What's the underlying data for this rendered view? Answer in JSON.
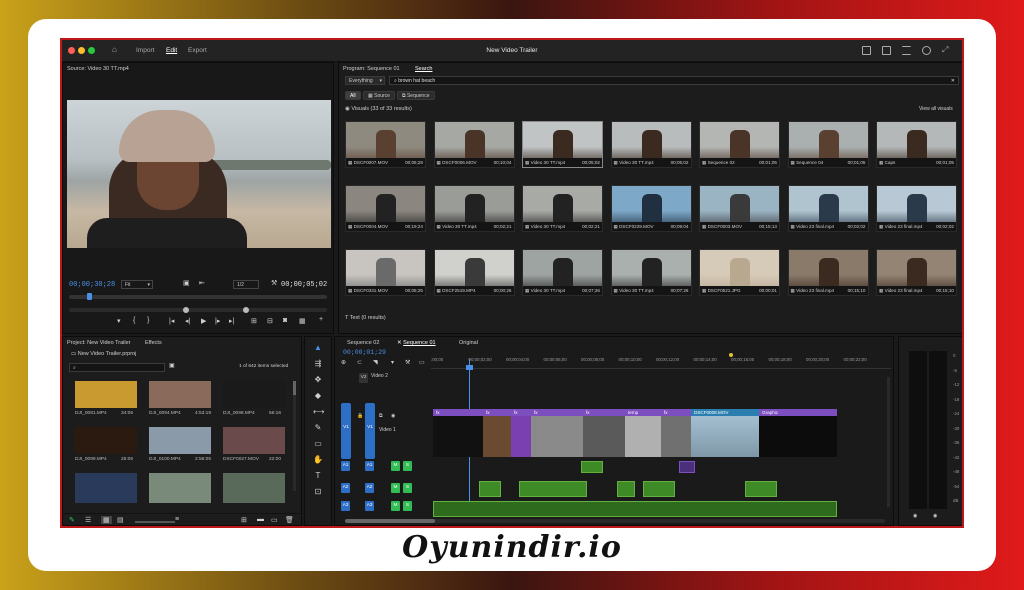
{
  "app": {
    "title": "New Video Trailer",
    "menu": [
      "Import",
      "Edit",
      "Export"
    ],
    "active_menu": "Edit"
  },
  "source": {
    "title": "Source: Video 30 TT.mp4",
    "timecode_in": "00;00;30;28",
    "fit": "Fit",
    "ratio": "1/2",
    "timecode_out": "00;00;05;02"
  },
  "program": {
    "tab": "Program: Sequence 01",
    "search_tab": "Search",
    "filter": "Everything",
    "query": "brown hat beach",
    "chips": [
      "All",
      "Source",
      "Sequence"
    ],
    "visuals_label": "Visuals (33 of 33 results)",
    "view_all": "View all visuals",
    "text_label": "Text (0 results)",
    "thumbs": [
      {
        "name": "DSCF0007.MOV",
        "dur": "00;06;28"
      },
      {
        "name": "DSCF0006.MOV",
        "dur": "00;10;04"
      },
      {
        "name": "Video 30 TT.mp4",
        "dur": "00;05;02"
      },
      {
        "name": "Video 30 TT.mp4",
        "dur": "00;05;02"
      },
      {
        "name": "Sequence 02",
        "dur": "00;01;05"
      },
      {
        "name": "Sequence 04",
        "dur": "00;01;05"
      },
      {
        "name": "Caps",
        "dur": "00;01;05"
      },
      {
        "name": "DSCF0004.MOV",
        "dur": "00;19;24"
      },
      {
        "name": "Video 30 TT.mp4",
        "dur": "00;02;21"
      },
      {
        "name": "Video 30 TT.mp4",
        "dur": "00;02;21"
      },
      {
        "name": "DSCF0229.MOV",
        "dur": "00;09;04"
      },
      {
        "name": "DSCF0003.MOV",
        "dur": "00;15;13"
      },
      {
        "name": "Video 23 final.mp4",
        "dur": "00;02;02"
      },
      {
        "name": "Video 23 final.mp4",
        "dur": "00;02;02"
      },
      {
        "name": "DSCF0331.MOV",
        "dur": "00;05;25"
      },
      {
        "name": "DSCF2519.MP4",
        "dur": "00;00;26"
      },
      {
        "name": "Video 30 TT.mp4",
        "dur": "00;07;26"
      },
      {
        "name": "Video 30 TT.mp4",
        "dur": "00;07;26"
      },
      {
        "name": "DSCF0521.JPG",
        "dur": "00;00;01"
      },
      {
        "name": "Video 23 final.mp4",
        "dur": "00;15;10"
      },
      {
        "name": "Video 23 final.mp4",
        "dur": "00;15;10"
      }
    ]
  },
  "project": {
    "tab": "Project: New Video Trailer",
    "effects_tab": "Effects",
    "file": "New Video Trailer.prproj",
    "count": "1 of 642 items selected",
    "items": [
      {
        "name": "DJI_0081.MP4",
        "dur": "34:06"
      },
      {
        "name": "DJI_0094.MP4",
        "dur": "4:53:19"
      },
      {
        "name": "DJI_0098.MP4",
        "dur": "56:16"
      },
      {
        "name": "DJI_0099.MP4",
        "dur": "25:06"
      },
      {
        "name": "DJI_0100.MP4",
        "dur": "2:56:05"
      },
      {
        "name": "DSCF0027.MOV",
        "dur": "22:00"
      }
    ]
  },
  "timeline": {
    "tabs": [
      "Sequence 02",
      "Sequence 01",
      "Original"
    ],
    "timecode": "00;00;01;29",
    "ruler": [
      ";00;00",
      "00;00;02;00",
      "00;00;04;00",
      "00;00;06;00",
      "00;00;08;00",
      "00;00;10;00",
      "00;00;12;00",
      "00;00;14;00",
      "00;00;16;00",
      "00;00;18;00",
      "00;00;20;00",
      "00;00;22;00"
    ],
    "tracks": {
      "v2": "V2",
      "v2_name": "Video 2",
      "v1": "V1",
      "v1_name": "Video 1",
      "a1": "A1",
      "a2": "A2",
      "a3": "A3",
      "m": "M",
      "s": "S"
    },
    "clips": {
      "c1": "temp",
      "c2": "DSCF0008.MOV",
      "c3": "Graphic"
    }
  },
  "meter": {
    "ticks": [
      "0",
      "-6",
      "-12",
      "-18",
      "-24",
      "-30",
      "-36",
      "-42",
      "-48",
      "-54",
      "dB"
    ]
  },
  "footer": {
    "logo": "Oyunindir.io"
  },
  "colors": {
    "accent": "#2d7ee0",
    "video_clip": "#7c4ec0",
    "audio_clip": "#3e8a26",
    "frame": "#c01818"
  }
}
